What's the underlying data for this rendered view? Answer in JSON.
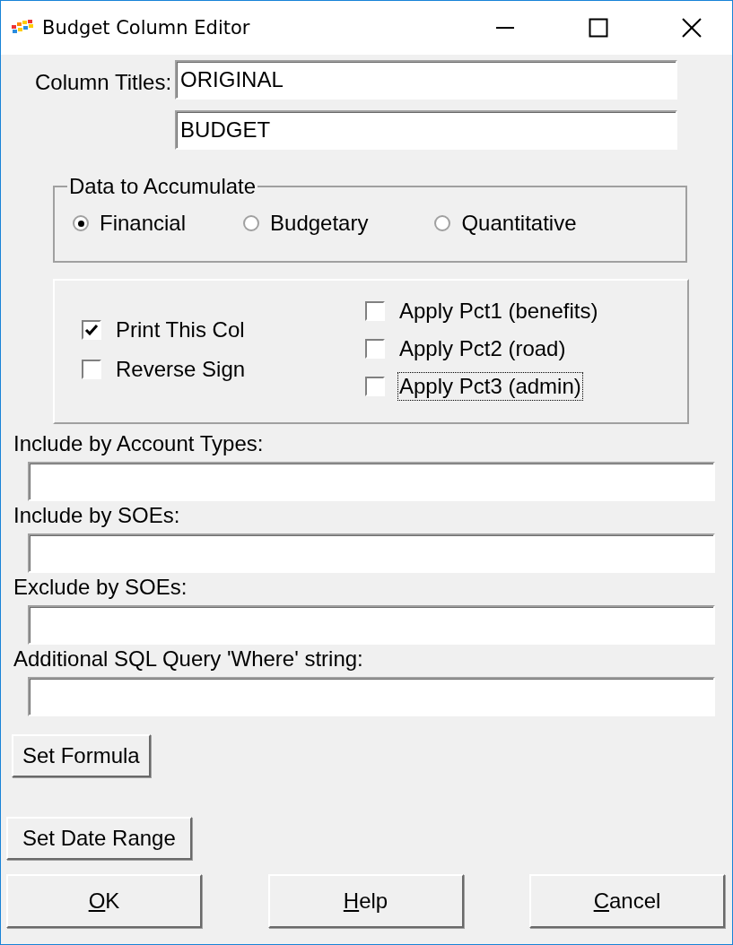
{
  "window": {
    "title": "Budget Column Editor"
  },
  "column_titles": {
    "label": "Column Titles:",
    "values": [
      "ORIGINAL",
      "BUDGET"
    ]
  },
  "data_to_accumulate": {
    "legend": "Data to Accumulate",
    "options": [
      {
        "label": "Financial",
        "selected": true
      },
      {
        "label": "Budgetary",
        "selected": false
      },
      {
        "label": "Quantitative",
        "selected": false
      }
    ]
  },
  "options_left": [
    {
      "label": "Print This Col",
      "checked": true,
      "focused": false
    },
    {
      "label": "Reverse Sign",
      "checked": false,
      "focused": false
    }
  ],
  "options_right": [
    {
      "label": "Apply Pct1 (benefits)",
      "checked": false,
      "focused": false
    },
    {
      "label": "Apply Pct2 (road)",
      "checked": false,
      "focused": false
    },
    {
      "label": "Apply Pct3 (admin)",
      "checked": false,
      "focused": true
    }
  ],
  "filters": [
    {
      "label": "Include by Account Types:"
    },
    {
      "label": "Include by SOEs:"
    },
    {
      "label": "Exclude by SOEs:"
    },
    {
      "label": "Additional SQL Query 'Where' string:"
    }
  ],
  "set_formula": {
    "label": "Set Formula"
  },
  "set_date_range": {
    "label": "Set Date Range"
  },
  "buttons": [
    {
      "label": "OK",
      "mnemonic_first": true
    },
    {
      "label": "Help",
      "mnemonic_first": true
    },
    {
      "label": "Cancel",
      "mnemonic_first": true
    }
  ]
}
